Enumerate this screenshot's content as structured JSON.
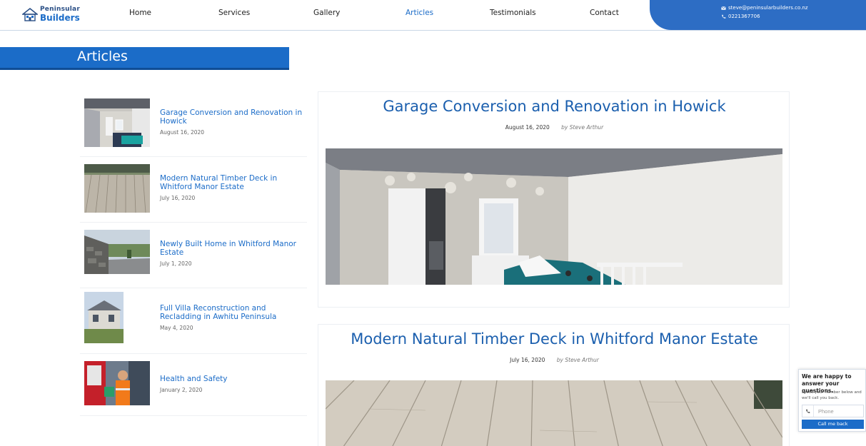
{
  "brand": {
    "line1": "Peninsular",
    "line2": "Builders"
  },
  "nav": [
    {
      "label": "Home",
      "active": false
    },
    {
      "label": "Services",
      "active": false
    },
    {
      "label": "Gallery",
      "active": false
    },
    {
      "label": "Articles",
      "active": true
    },
    {
      "label": "Testimonials",
      "active": false
    },
    {
      "label": "Contact",
      "active": false
    }
  ],
  "contact": {
    "email": "steve@peninsularbuilders.co.nz",
    "phone": "0221367706",
    "email_icon": "envelope-icon",
    "phone_icon": "phone-icon"
  },
  "banner": {
    "title": "Articles"
  },
  "sidebar": {
    "items": [
      {
        "title": "Garage Conversion and Renovation in Howick",
        "date": "August 16, 2020"
      },
      {
        "title": "Modern Natural Timber Deck in Whitford Manor Estate",
        "date": "July 16, 2020"
      },
      {
        "title": "Newly Built Home in Whitford Manor Estate",
        "date": "July 1, 2020"
      },
      {
        "title": "Full Villa Reconstruction and Recladding in Awhitu Peninsula",
        "date": "May 4, 2020"
      },
      {
        "title": "Health and Safety",
        "date": "January 2, 2020"
      }
    ]
  },
  "articles": [
    {
      "title": "Garage Conversion and Renovation in Howick",
      "date": "August 16, 2020",
      "author": "by Steve Arthur"
    },
    {
      "title": "Modern Natural Timber Deck in Whitford Manor Estate",
      "date": "July 16, 2020",
      "author": "by Steve Arthur"
    }
  ],
  "widget": {
    "heading": "We are happy to answer your questions.",
    "subtext": "Leave your number below and we'll call you back.",
    "phone_placeholder": "Phone",
    "button_label": "Call me back"
  },
  "colors": {
    "brand_blue": "#1b6cc8",
    "header_blue": "#2d6dc4",
    "title_blue": "#1b5fae"
  }
}
